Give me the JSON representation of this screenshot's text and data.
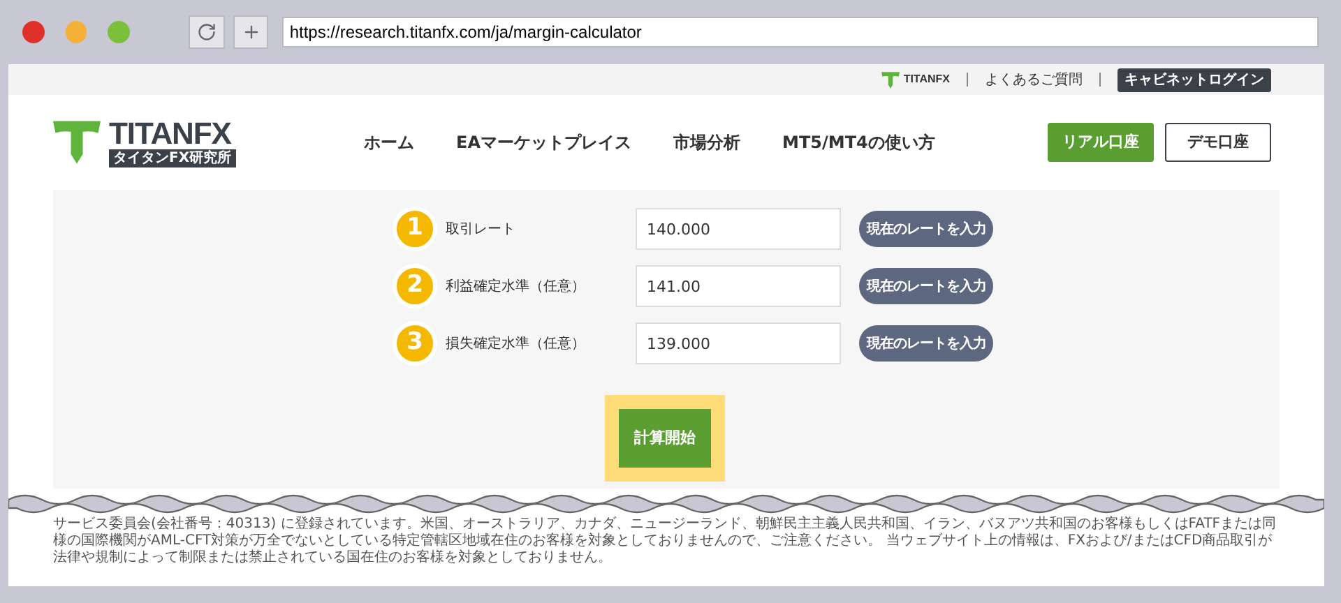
{
  "browser": {
    "url": "https://research.titanfx.com/ja/margin-calculator"
  },
  "utility_bar": {
    "logo_text": "TITANFX",
    "links": [
      "よくあるご質問"
    ],
    "login_button": "キャビネットログイン"
  },
  "header": {
    "logo": {
      "name": "TITANFX",
      "subtitle": "タイタンFX研究所"
    },
    "nav": [
      "ホーム",
      "EAマーケットプレイス",
      "市場分析",
      "MT5/MT4の使い方"
    ],
    "buttons": [
      {
        "label": "リアル口座",
        "kind": "primary"
      },
      {
        "label": "デモ口座",
        "kind": "outline"
      }
    ]
  },
  "form": {
    "rows": [
      {
        "step": "1",
        "label": "取引レート",
        "value": "140.000",
        "button": "現在のレートを入力"
      },
      {
        "step": "2",
        "label": "利益確定水準（任意）",
        "value": "141.00",
        "button": "現在のレートを入力"
      },
      {
        "step": "3",
        "label": "損失確定水準（任意）",
        "value": "139.000",
        "button": "現在のレートを入力"
      }
    ],
    "submit": "計算開始"
  },
  "footer": {
    "text": "サービス委員会(会社番号：40313) に登録されています。米国、オーストラリア、カナダ、ニュージーランド、朝鮮民主主義人民共和国、イラン、バヌアツ共和国のお客様もしくはFATFまたは同様の国際機関がAML-CFT対策が万全でないとしている特定管轄区地域在住のお客様を対象としておりませんので、ご注意ください。 当ウェブサイト上の情報は、FXおよび/またはCFD商品取引が法律や規制によって制限または禁止されている国在住のお客様を対象としておりません。"
  }
}
